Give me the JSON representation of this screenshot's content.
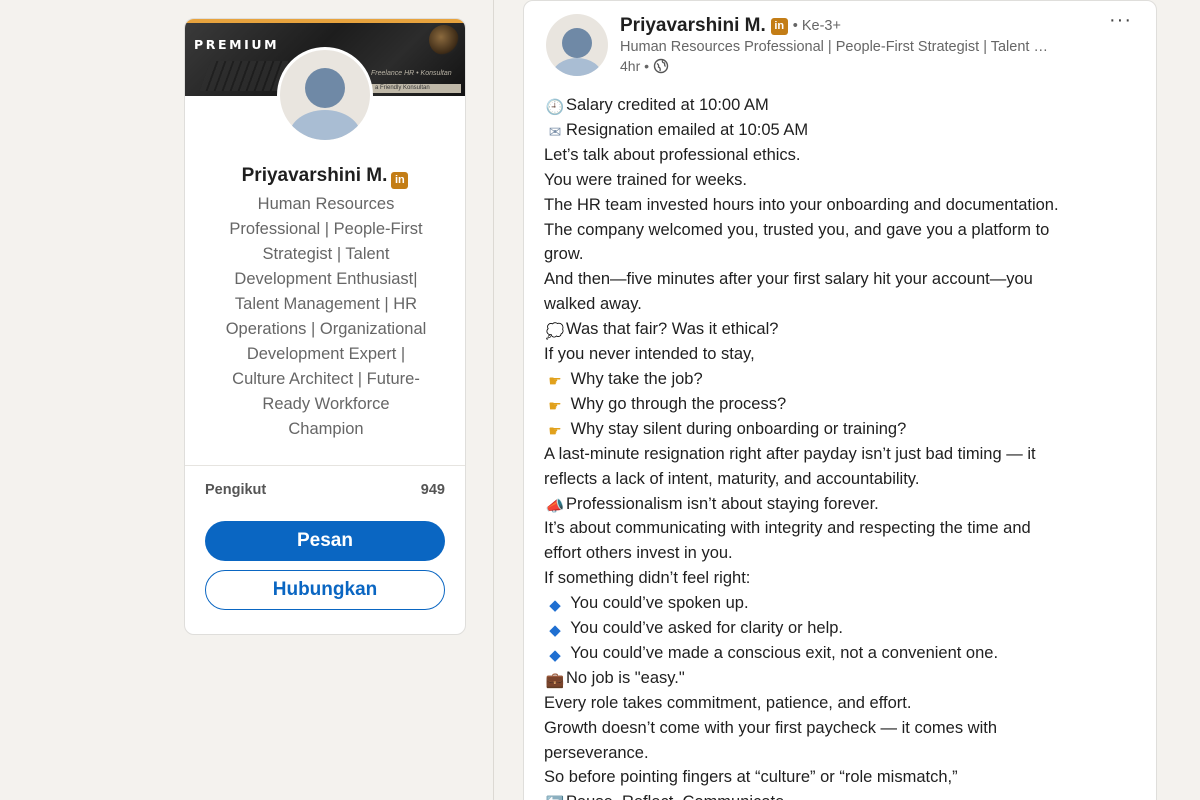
{
  "profile_card": {
    "premium_label": "PREMIUM",
    "banner_script": "Freelance HR • Konsultan",
    "banner_strip": "a Friendly Konsultan",
    "name": "Priyavarshini M.",
    "linkedin_badge": "in",
    "headline_lines": [
      "Human Resources",
      "Professional | People-First",
      "Strategist | Talent",
      "Development Enthusiast|",
      "Talent Management | HR",
      "Operations | Organizational",
      "Development Expert |",
      "Culture Architect | Future-",
      "Ready Workforce",
      "Champion"
    ],
    "followers_label": "Pengikut",
    "followers_count": "949",
    "message_button": "Pesan",
    "connect_button": "Hubungkan"
  },
  "post": {
    "author_name": "Priyavarshini M.",
    "linkedin_badge": "in",
    "degree": "• Ke-3+",
    "author_headline": "Human Resources Professional | People-First Strategist | Talent …",
    "time": "4hr •",
    "more_label": "···",
    "lines": [
      {
        "icon": "🕘",
        "cls": "clock",
        "text": "Salary credited at 10:00 AM"
      },
      {
        "icon": "✉",
        "cls": "mail",
        "text": "Resignation emailed at 10:05 AM"
      },
      {
        "icon": "",
        "cls": "",
        "text": "Let’s talk about professional ethics."
      },
      {
        "icon": "",
        "cls": "",
        "text": "You were trained for weeks."
      },
      {
        "icon": "",
        "cls": "",
        "text": "The HR team invested hours into your onboarding and documentation."
      },
      {
        "icon": "",
        "cls": "",
        "text": "The company welcomed you, trusted you, and gave you a platform to"
      },
      {
        "icon": "",
        "cls": "",
        "text": "grow."
      },
      {
        "icon": "",
        "cls": "",
        "text": "And then—five minutes after your first salary hit your account—you"
      },
      {
        "icon": "",
        "cls": "",
        "text": "walked away."
      },
      {
        "icon": "💭",
        "cls": "bubble",
        "text": "Was that fair? Was it ethical?"
      },
      {
        "icon": "",
        "cls": "",
        "text": "If you never intended to stay,"
      },
      {
        "icon": "☛",
        "cls": "point",
        "text": " Why take the job?"
      },
      {
        "icon": "☛",
        "cls": "point",
        "text": " Why go through the process?"
      },
      {
        "icon": "☛",
        "cls": "point",
        "text": " Why stay silent during onboarding or training?"
      },
      {
        "icon": "",
        "cls": "",
        "text": "A last-minute resignation right after payday isn’t just bad timing — it"
      },
      {
        "icon": "",
        "cls": "",
        "text": "reflects a lack of intent, maturity, and accountability."
      },
      {
        "icon": "📣",
        "cls": "mega",
        "text": "Professionalism isn’t about staying forever."
      },
      {
        "icon": "",
        "cls": "",
        "text": " It’s about communicating with integrity and respecting the time and"
      },
      {
        "icon": "",
        "cls": "",
        "text": "effort others invest in you."
      },
      {
        "icon": "",
        "cls": "",
        "text": "If something didn’t feel right:"
      },
      {
        "icon": "◆",
        "cls": "diamond",
        "text": " You could’ve spoken up."
      },
      {
        "icon": "◆",
        "cls": "diamond",
        "text": " You could’ve asked for clarity or help."
      },
      {
        "icon": "◆",
        "cls": "diamond",
        "text": " You could’ve made a conscious exit, not a convenient one."
      },
      {
        "icon": "💼",
        "cls": "brief",
        "text": "No job is \"easy.\""
      },
      {
        "icon": "",
        "cls": "",
        "text": "Every role takes commitment, patience, and effort."
      },
      {
        "icon": "",
        "cls": "",
        "text": "Growth doesn’t come with your first paycheck — it comes with"
      },
      {
        "icon": "",
        "cls": "",
        "text": "perseverance."
      },
      {
        "icon": "",
        "cls": "",
        "text": "So before pointing fingers at “culture” or “role mismatch,”"
      },
      {
        "icon": "🔄",
        "cls": "refresh",
        "text": "Pause. Reflect. Communicate."
      }
    ]
  },
  "colors": {
    "page_bg": "#f4f2ee",
    "primary_blue": "#0a66c2",
    "premium_gold": "#e7a33e",
    "linkedin_badge_gold": "#c37d16"
  },
  "icons": {
    "more": "more-options-icon",
    "visibility": "globe-icon",
    "verified": "linkedin-badge-icon"
  }
}
